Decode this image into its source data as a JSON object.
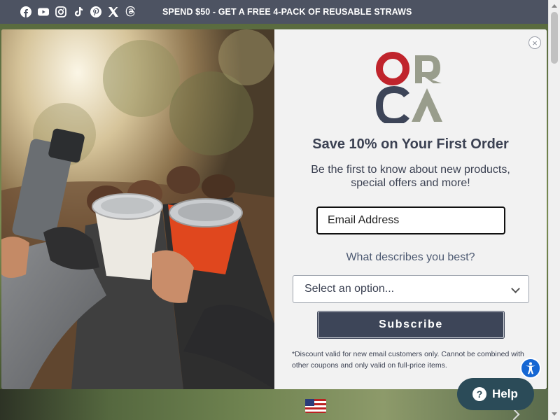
{
  "topbar": {
    "promo_text": "SPEND $50 - GET A FREE 4-PACK OF REUSABLE STRAWS",
    "socials": [
      "facebook-icon",
      "youtube-icon",
      "instagram-icon",
      "tiktok-icon",
      "pinterest-icon",
      "x-icon",
      "threads-icon"
    ]
  },
  "modal": {
    "close_label": "×",
    "logo": {
      "top_left": "O",
      "top_right": "R",
      "bottom_left": "C",
      "bottom_right": "A",
      "colors": {
        "red": "#c0242c",
        "gray": "#999d8c",
        "navy": "#3d4558"
      }
    },
    "headline": "Save 10% on Your First Order",
    "subtext": "Be the first to know about new products, special offers and more!",
    "email_placeholder": "Email Address",
    "question": "What describes you best?",
    "select_value": "Select an option...",
    "subscribe_label": "Subscribe",
    "disclaimer": "*Discount valid for new email customers only. Cannot be combined with other coupons and only valid on full-price items."
  },
  "help": {
    "label": "Help",
    "q": "?"
  },
  "colors": {
    "topbar": "#4d5362",
    "button": "#3d4558",
    "help": "#2b4b58",
    "accessibility": "#1667d3"
  }
}
